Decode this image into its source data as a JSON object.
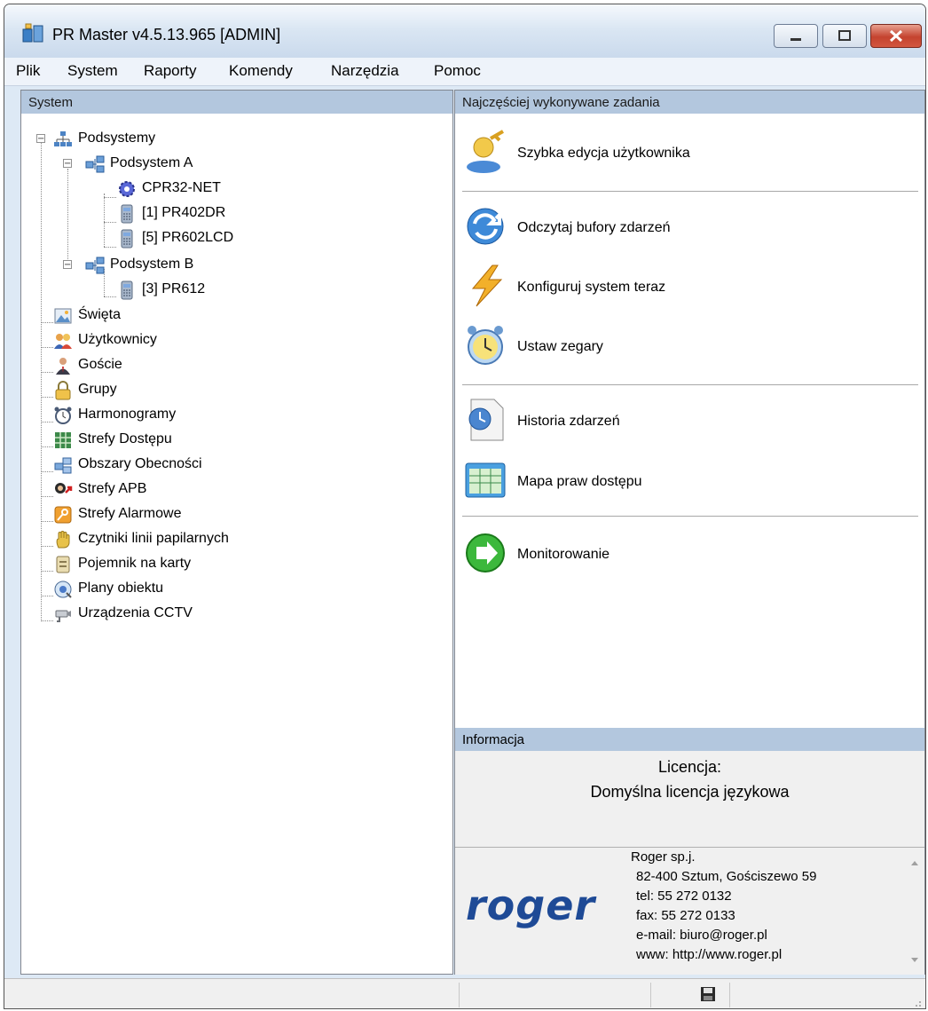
{
  "window": {
    "title": "PR Master v4.5.13.965 [ADMIN]"
  },
  "menu": [
    "Plik",
    "System",
    "Raporty",
    "Komendy",
    "Narzędzia",
    "Pomoc"
  ],
  "left_panel": {
    "header": "System",
    "tree": [
      {
        "label": "Podsystemy",
        "icon": "network-icon"
      },
      {
        "label": "Podsystem A",
        "icon": "subsystem-icon"
      },
      {
        "label": "CPR32-NET",
        "icon": "gear-icon"
      },
      {
        "label": "[1] PR402DR",
        "icon": "controller-icon"
      },
      {
        "label": "[5] PR602LCD",
        "icon": "controller-icon"
      },
      {
        "label": "Podsystem B",
        "icon": "subsystem-icon"
      },
      {
        "label": "[3] PR612",
        "icon": "controller-icon"
      },
      {
        "label": "Święta",
        "icon": "picture-icon"
      },
      {
        "label": "Użytkownicy",
        "icon": "users-icon"
      },
      {
        "label": "Goście",
        "icon": "guest-icon"
      },
      {
        "label": "Grupy",
        "icon": "lock-icon"
      },
      {
        "label": "Harmonogramy",
        "icon": "alarm-clock-icon"
      },
      {
        "label": "Strefy Dostępu",
        "icon": "grid-icon"
      },
      {
        "label": "Obszary Obecności",
        "icon": "attendance-icon"
      },
      {
        "label": "Strefy APB",
        "icon": "apb-icon"
      },
      {
        "label": "Strefy Alarmowe",
        "icon": "alarm-zone-icon"
      },
      {
        "label": "Czytniki linii papilarnych",
        "icon": "hand-icon"
      },
      {
        "label": "Pojemnik na karty",
        "icon": "card-box-icon"
      },
      {
        "label": "Plany obiektu",
        "icon": "map-icon"
      },
      {
        "label": "Urządzenia CCTV",
        "icon": "camera-icon"
      }
    ]
  },
  "right_panel": {
    "header": "Najczęściej wykonywane zadania",
    "tasks": [
      {
        "label": "Szybka edycja użytkownika",
        "icon": "user-edit-icon"
      },
      {
        "label": "Odczytaj bufory zdarzeń",
        "icon": "refresh-icon"
      },
      {
        "label": "Konfiguruj system teraz",
        "icon": "lightning-icon"
      },
      {
        "label": "Ustaw zegary",
        "icon": "clock-icon"
      },
      {
        "label": "Historia zdarzeń",
        "icon": "history-icon"
      },
      {
        "label": "Mapa praw dostępu",
        "icon": "access-map-icon"
      },
      {
        "label": "Monitorowanie",
        "icon": "play-icon"
      }
    ],
    "info_header": "Informacja",
    "license_title": "Licencja:",
    "license_value": "Domyślna licencja językowa",
    "company": {
      "logo": "roger",
      "lines": [
        "Roger sp.j.",
        "82-400 Sztum, Gościszewo 59",
        "tel: 55 272 0132",
        "fax: 55 272 0133",
        "e-mail: biuro@roger.pl",
        "www: http://www.roger.pl"
      ]
    }
  },
  "statusbar": {
    "save_icon": "floppy-icon"
  }
}
